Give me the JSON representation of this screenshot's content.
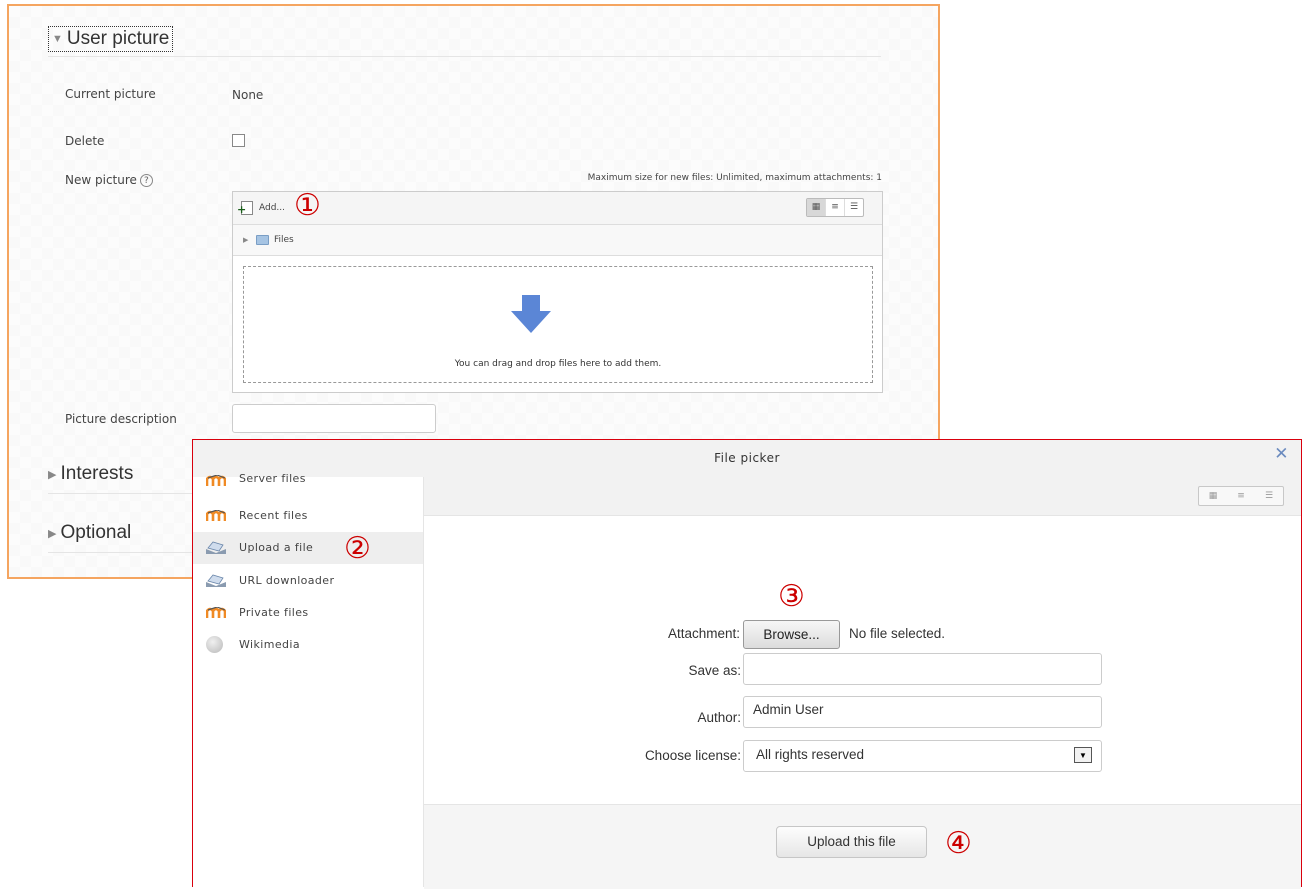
{
  "form": {
    "user_picture_heading": "User picture",
    "current_picture_label": "Current picture",
    "current_picture_value": "None",
    "delete_label": "Delete",
    "new_picture_label": "New picture",
    "help_glyph": "?",
    "max_size_text": "Maximum size for new files: Unlimited, maximum attachments: 1",
    "add_label": "Add...",
    "folder_path": "Files",
    "drop_text": "You can drag and drop files here to add them.",
    "picture_description_label": "Picture description",
    "picture_description_value": "",
    "interests_heading": "Interests",
    "optional_heading": "Optional"
  },
  "markers": [
    "①",
    "②",
    "③",
    "④"
  ],
  "picker": {
    "title": "File picker",
    "close_glyph": "✕",
    "repositories": [
      {
        "label": "Server files",
        "icon": "moodle-icon",
        "active": false
      },
      {
        "label": "Recent files",
        "icon": "moodle-icon",
        "active": false
      },
      {
        "label": "Upload a file",
        "icon": "upload-icon",
        "active": true
      },
      {
        "label": "URL downloader",
        "icon": "upload-icon",
        "active": false
      },
      {
        "label": "Private files",
        "icon": "moodle-icon",
        "active": false
      },
      {
        "label": "Wikimedia",
        "icon": "wikimedia-icon",
        "active": false
      }
    ],
    "attachment_label": "Attachment:",
    "browse_label": "Browse...",
    "no_file_text": "No file selected.",
    "save_as_label": "Save as:",
    "save_as_value": "",
    "author_label": "Author:",
    "author_value": "Admin User",
    "license_label": "Choose license:",
    "license_value": "All rights reserved",
    "upload_button_label": "Upload this file"
  },
  "colors": {
    "form_border": "#f5a560",
    "picker_border": "#d9000d",
    "marker_red": "#cc0000",
    "drop_arrow": "#5b86d6"
  }
}
